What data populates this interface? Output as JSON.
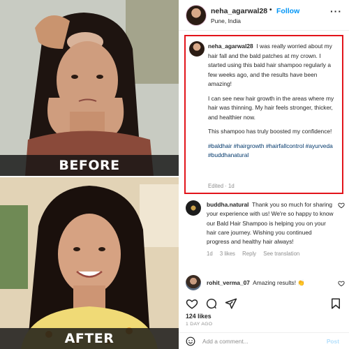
{
  "left": {
    "before_label": "BEFORE",
    "after_label": "AFTER"
  },
  "header": {
    "username": "neha_agarwal28",
    "separator": "•",
    "follow_label": "Follow",
    "location": "Pune, India",
    "more_icon": "more-horizontal-icon"
  },
  "caption": {
    "username": "neha_agarwal28",
    "paragraph1": "I was really worried about my hair fall and the bald patches at my crown. I started using this bald hair shampoo regularly a few weeks ago, and the results have been amazing!",
    "paragraph2": "I can see new hair growth in the areas where my hair was thinning. My hair feels stronger, thicker, and healthier now.",
    "paragraph3": "This shampoo has truly boosted my confidence!",
    "hashtags": "#baldhair #hairgrowth #hairfallcontrol #ayurveda #buddhanatural",
    "meta": "Edited · 1d",
    "highlight_color": "#e2141b"
  },
  "comments": [
    {
      "username": "buddha.natural",
      "text": "Thank you so much for sharing your experience with us! We're so happy to know our Bald Hair Shampoo is helping you on your hair care journey. Wishing you continued progress and healthy hair always!",
      "time": "1d",
      "likes": "3 likes",
      "reply": "Reply",
      "see_translation": "See translation"
    },
    {
      "username": "rohit_verma_07",
      "text": "Amazing results!",
      "emoji": "👏"
    }
  ],
  "actions": {
    "like_icon": "heart-icon",
    "comment_icon": "comment-icon",
    "share_icon": "send-icon",
    "save_icon": "bookmark-icon"
  },
  "likes": "124 likes",
  "date": "1 DAY AGO",
  "add_comment": {
    "placeholder": "Add a comment...",
    "post_label": "Post",
    "emoji_icon": "smile-icon"
  },
  "colors": {
    "link_blue": "#0095f6",
    "hashtag": "#00376b",
    "muted": "#8e8e8e"
  }
}
